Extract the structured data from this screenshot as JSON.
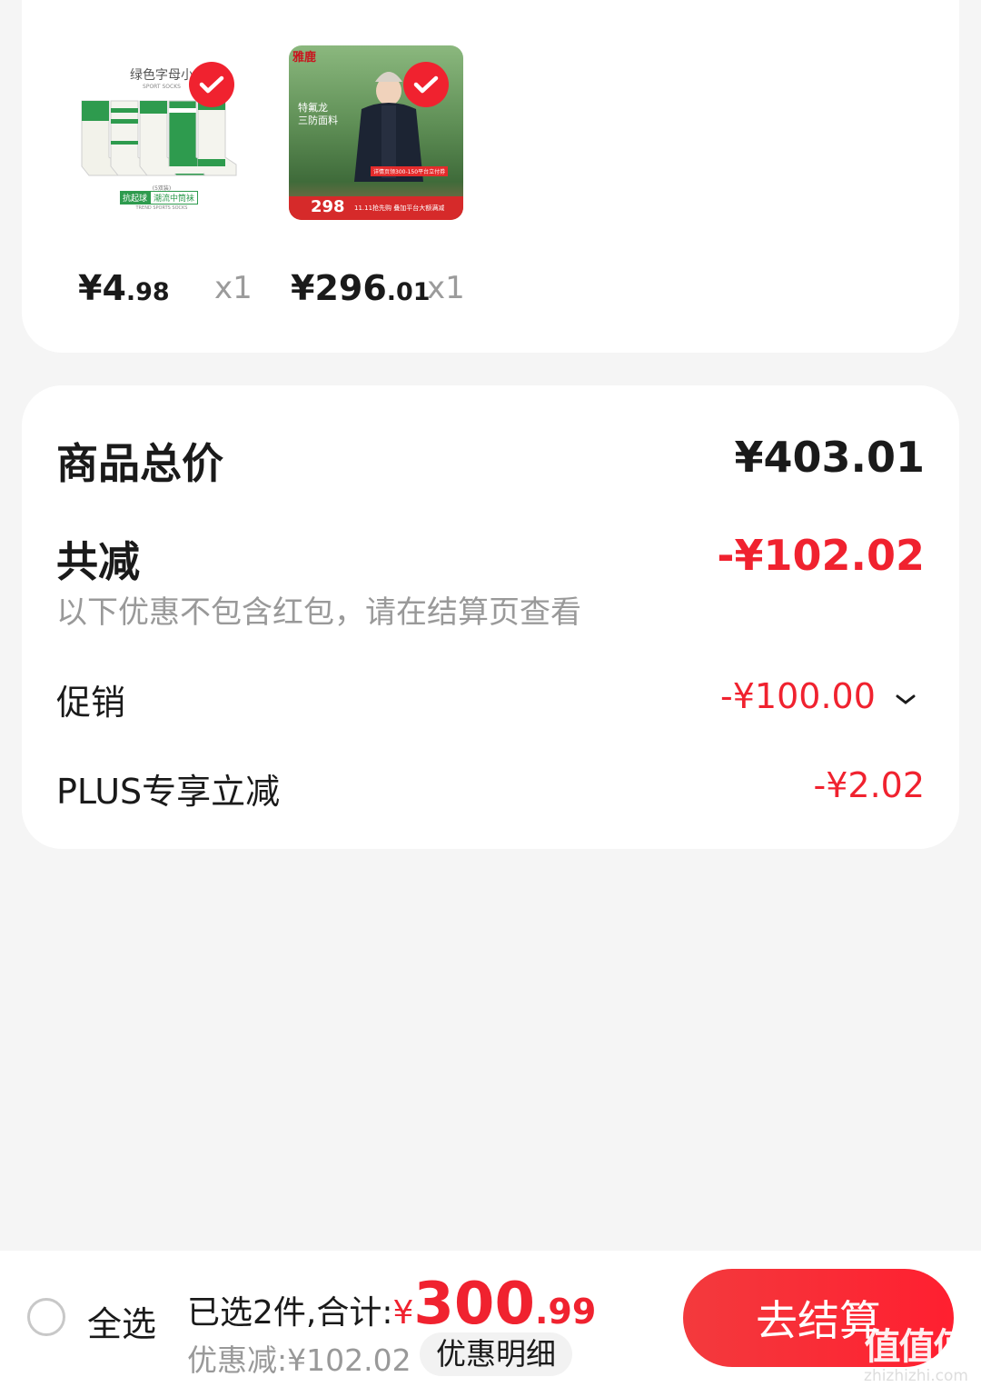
{
  "items": [
    {
      "image": {
        "title": "绿色字母小",
        "subtitle": "SPORT SOCKS",
        "note": "(5双装)",
        "tag1": "抗起球",
        "tag2": "潮流中筒袜",
        "tag3": "TREND SPORTS SOCKS"
      },
      "price_int": "¥4",
      "price_dec": ".98",
      "qty": "x1"
    },
    {
      "image": {
        "brand": "雅鹿",
        "line1": "特氟龙",
        "line2": "三防面料",
        "promo": "详情页领300-150平台立付券",
        "promo2": "11.11抢先购 叠加平台大额满减",
        "price": "298"
      },
      "price_int": "¥296",
      "price_dec": ".01",
      "qty": "x1"
    }
  ],
  "summary": {
    "total_label": "商品总价",
    "total_value": "¥403.01",
    "reduce_label": "共减",
    "reduce_value": "-¥102.02",
    "note": "以下优惠不包含红包，请在结算页查看",
    "promo_label": "促销",
    "promo_value": "-¥100.00",
    "plus_label": "PLUS专享立减",
    "plus_value": "-¥2.02"
  },
  "bottom": {
    "select_all": "全选",
    "selected_text": "已选2件,合计:",
    "currency": "¥",
    "total_int": "300",
    "total_dec": ".99",
    "discount_text": "优惠减:¥102.02",
    "detail_chip": "优惠明细",
    "checkout": "去结算"
  },
  "watermark": {
    "logo": "值值值",
    "site": "zhizhizhi.com"
  },
  "colors": {
    "accent": "#f0222f",
    "background": "#f5f5f5",
    "card": "#ffffff"
  },
  "icons": {
    "check": "check-icon",
    "dropdown": "chevron-down-icon",
    "radio": "radio-unchecked-icon"
  }
}
